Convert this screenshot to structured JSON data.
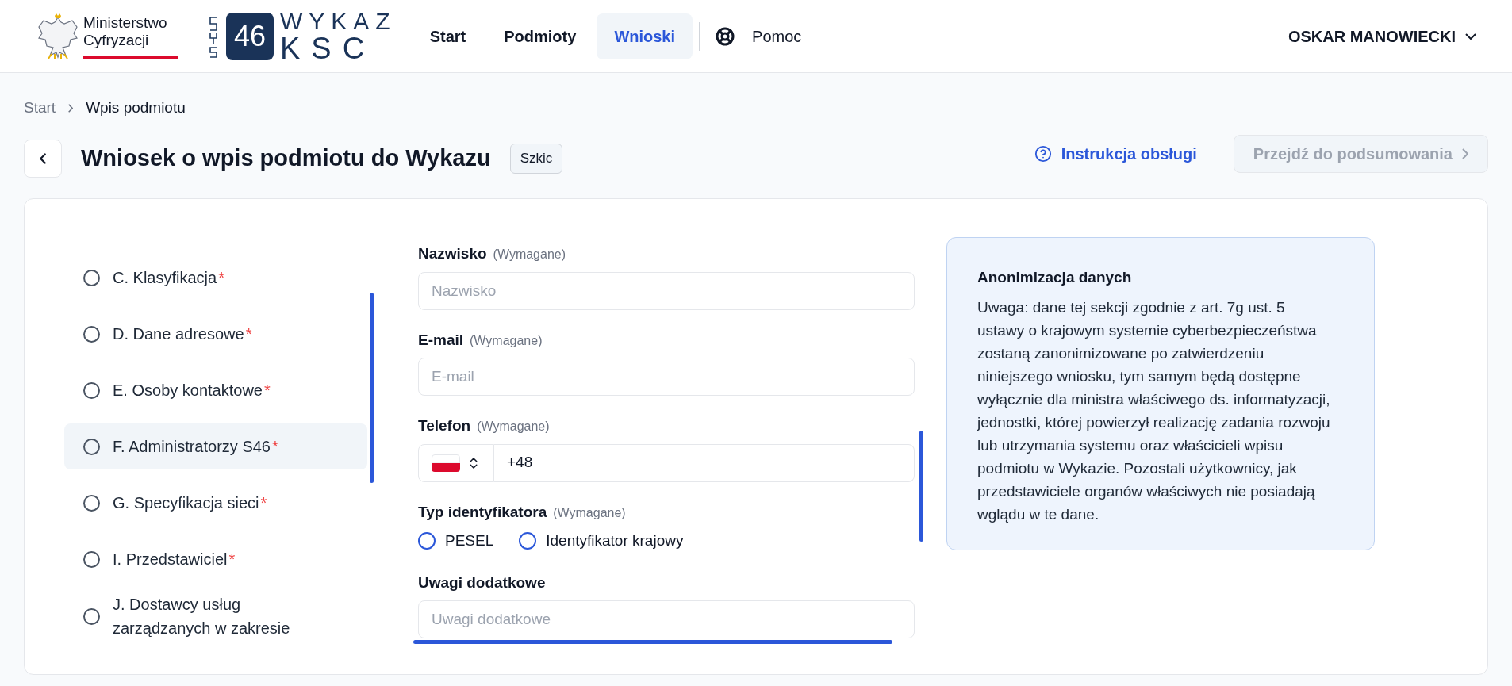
{
  "header": {
    "ministry_logo": {
      "line_1": "Ministerstwo",
      "line_2": "Cyfryzacji"
    },
    "app_logo": {
      "number": "46",
      "word_1": "WYKAZ",
      "word_2": "KSC"
    },
    "nav": [
      {
        "label": "Start",
        "selected": false,
        "kind": "link"
      },
      {
        "label": "Podmioty",
        "selected": false,
        "kind": "link"
      },
      {
        "label": "Wnioski",
        "selected": true,
        "kind": "link"
      },
      {
        "label": "Pomoc",
        "selected": false,
        "kind": "help"
      }
    ],
    "user": "OSKAR MANOWIECKI"
  },
  "breadcrumb": [
    "Start",
    "Wpis podmiotu"
  ],
  "title": "Wniosek o wpis podmiotu do Wykazu",
  "status_badge": "Szkic",
  "help_link": "Instrukcja obsługi",
  "summary_button": {
    "label": "Przejdź do podsumowania",
    "disabled": true
  },
  "sections": [
    {
      "label": "C. Klasyfikacja",
      "required_mark": "*",
      "selected": false
    },
    {
      "label": "D. Dane adresowe",
      "required_mark": "*",
      "selected": false
    },
    {
      "label": "E. Osoby kontaktowe",
      "required_mark": "*",
      "selected": false
    },
    {
      "label": "F. Administratorzy S46",
      "required_mark": "*",
      "selected": true
    },
    {
      "label": "G. Specyfikacja sieci",
      "required_mark": "*",
      "selected": false
    },
    {
      "label": "I. Przedstawiciel",
      "required_mark": "*",
      "selected": false
    },
    {
      "label": "J. Dostawcy usług zarządzanych w zakresie",
      "selected": false
    }
  ],
  "form": [
    {
      "kind": "text",
      "label": "Nazwisko",
      "hint": "(Wymagane)",
      "placeholder": "Nazwisko"
    },
    {
      "kind": "text",
      "label": "E-mail",
      "hint": "(Wymagane)",
      "placeholder": "E-mail"
    },
    {
      "kind": "phone",
      "label": "Telefon",
      "hint": "(Wymagane)",
      "value": "+48"
    },
    {
      "kind": "radio",
      "label": "Typ identyfikatora",
      "hint": "(Wymagane)",
      "options": [
        {
          "label": "PESEL",
          "selected": false
        },
        {
          "label": "Identyfikator krajowy",
          "selected": false
        }
      ]
    },
    {
      "kind": "text",
      "label": "Uwagi dodatkowe",
      "placeholder": "Uwagi dodatkowe"
    }
  ],
  "info_box": {
    "title": "Anonimizacja danych",
    "text": "Uwaga: dane tej sekcji zgodnie z art. 7g ust. 5 ustawy o krajowym systemie cyberbezpieczeństwa zostaną zanonimizowane po zatwierdzeniu niniejszego wniosku, tym samym będą dostępne wyłącznie dla ministra właściwego ds. informatyzacji, jednostki, której powierzył realizację zadania rozwoju lub utrzymania systemu oraz właścicieli wpisu podmiotu w Wykazie. Pozostali użytkownicy, jak przedstawiciele organów właściwych nie posiadają wglądu w te dane."
  }
}
